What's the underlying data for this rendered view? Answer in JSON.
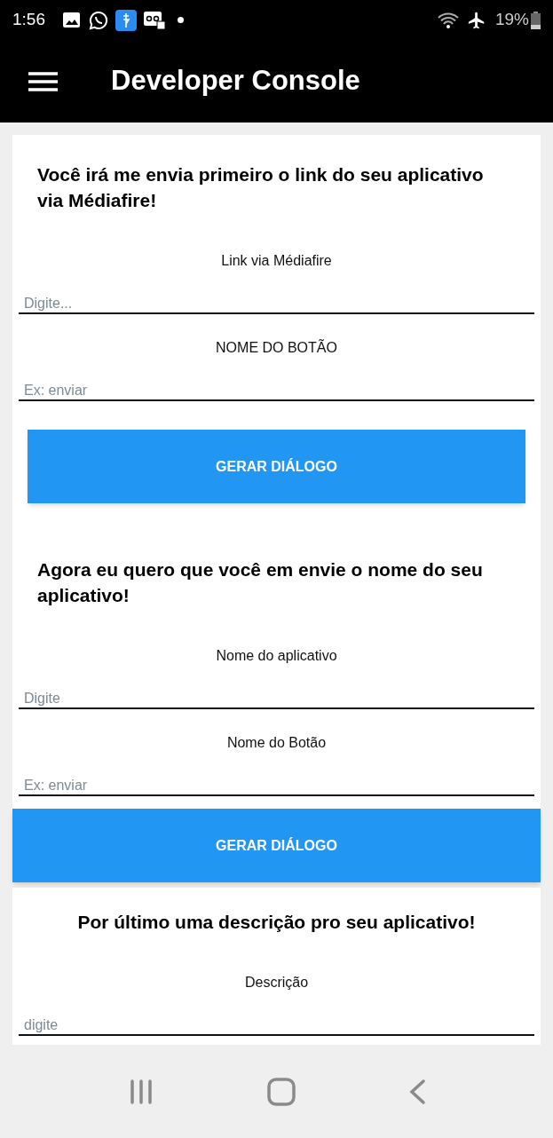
{
  "status_bar": {
    "time": "1:56",
    "battery": "19%"
  },
  "app_bar": {
    "title": "Developer Console"
  },
  "sections": [
    {
      "heading": "Você irá me envia primeiro o link do seu aplicativo via Médiafire!",
      "kind": "left",
      "fields": [
        {
          "label": "Link via Médiafire",
          "placeholder": "Digite..."
        },
        {
          "label": "NOME DO BOTÃO",
          "placeholder": "Ex: enviar"
        }
      ],
      "button": {
        "label": "GERAR DIÁLOGO",
        "kind": "inset"
      }
    },
    {
      "heading": "Agora eu quero que você em envie o nome do seu aplicativo!",
      "kind": "left",
      "fields": [
        {
          "label": "Nome do aplicativo",
          "placeholder": "Digite"
        },
        {
          "label": "Nome do Botão",
          "placeholder": "Ex: enviar"
        }
      ],
      "button": {
        "label": "GERAR DIÁLOGO",
        "kind": "full"
      }
    },
    {
      "heading": "Por último uma descrição pro seu aplicativo!",
      "kind": "centered",
      "fields": [
        {
          "label": "Descrição",
          "placeholder": "digite"
        }
      ]
    }
  ]
}
